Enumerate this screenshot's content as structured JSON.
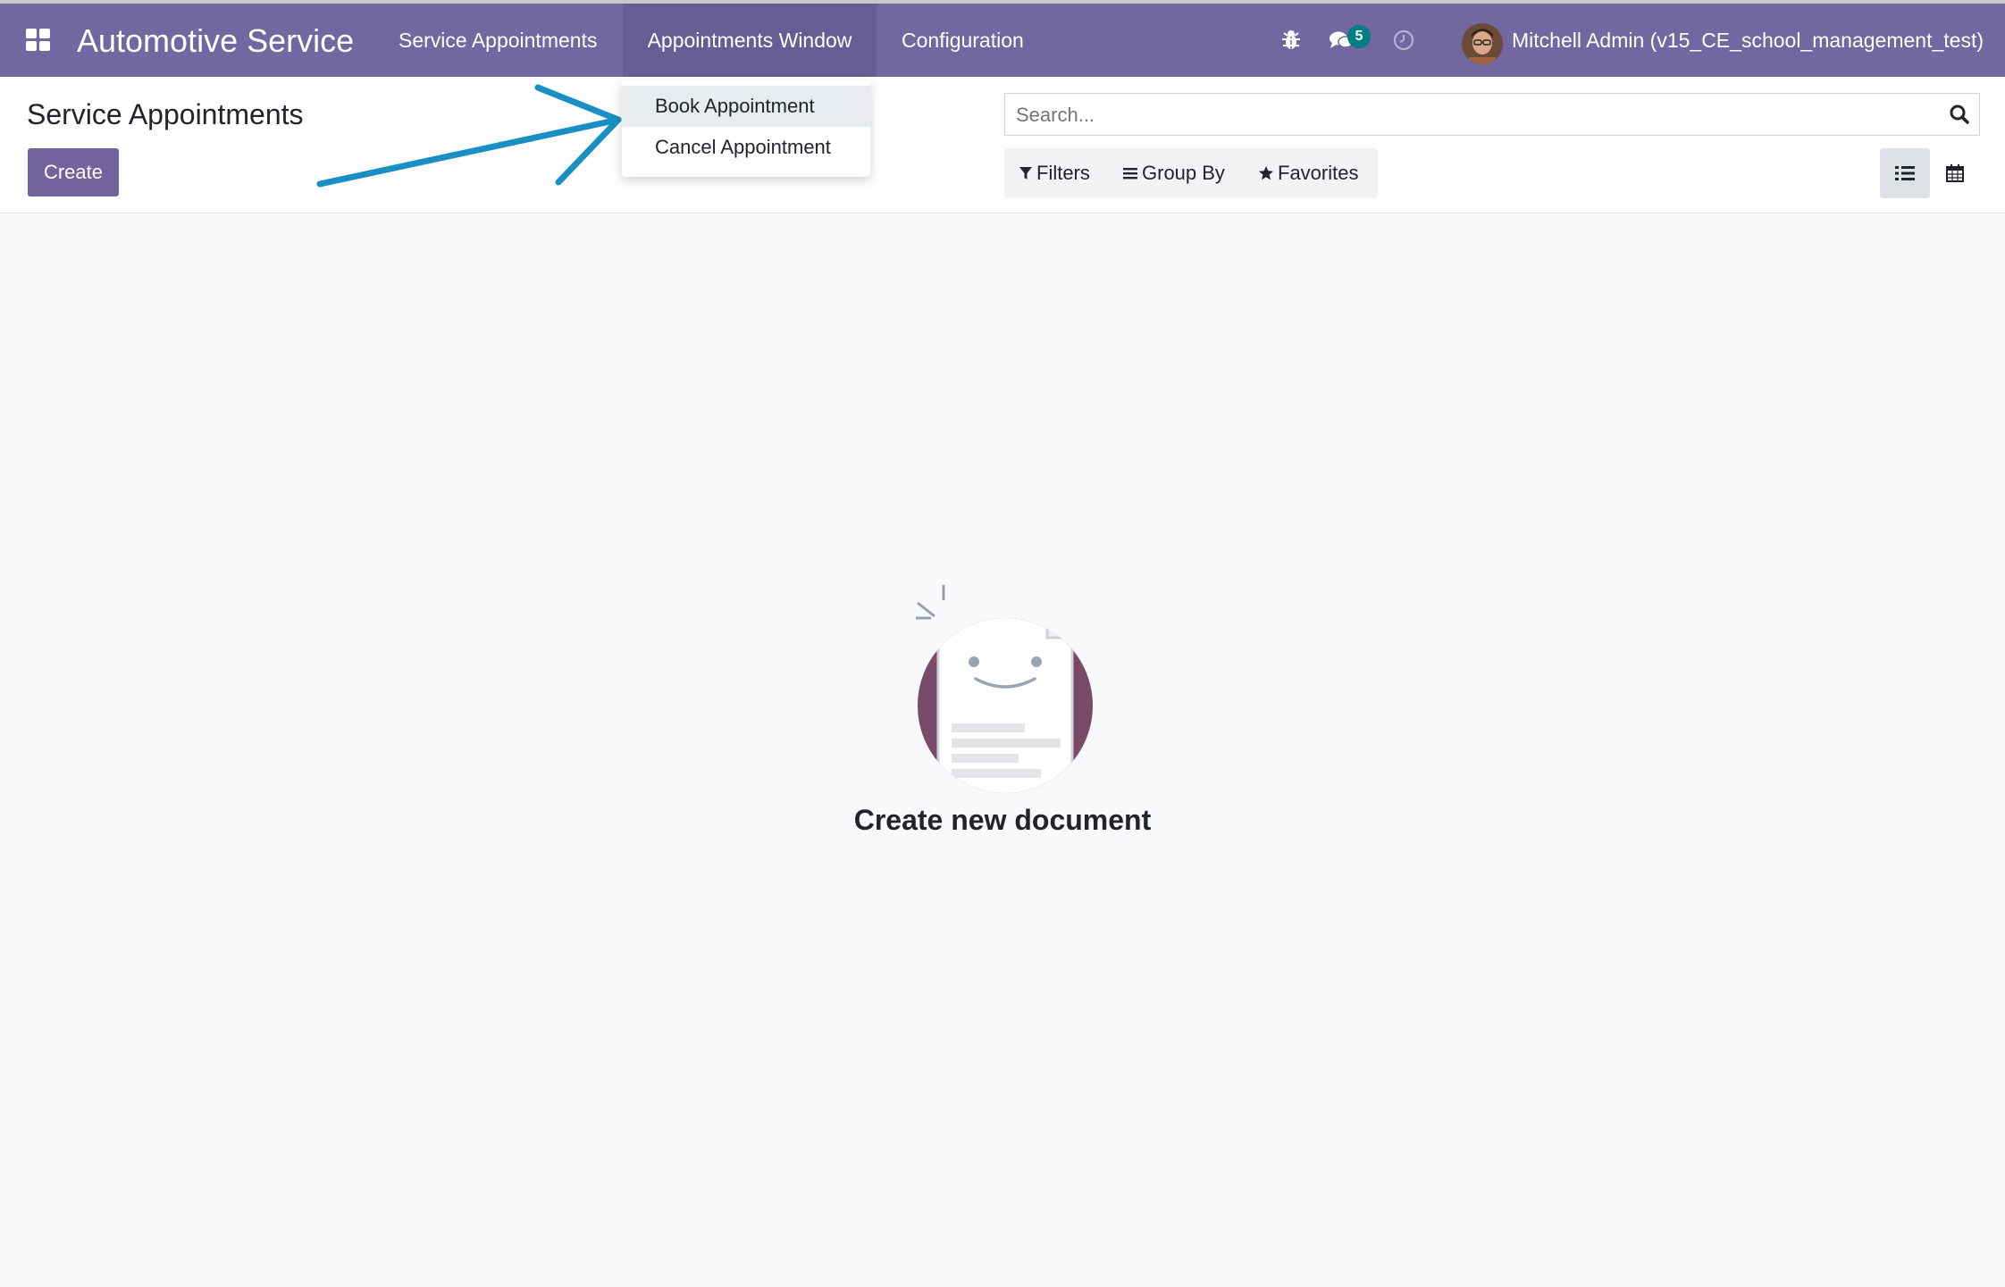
{
  "navbar": {
    "brand": "Automotive Service",
    "menu": [
      "Service Appointments",
      "Appointments Window",
      "Configuration"
    ],
    "active_menu": "Appointments Window",
    "messages_count": "5",
    "user": "Mitchell Admin (v15_CE_school_management_test)",
    "color": "#7267a0",
    "icons": [
      "apps-grid-icon",
      "bug-icon",
      "chat-icon",
      "clock-icon",
      "avatar"
    ]
  },
  "dropdown": {
    "items": [
      "Book Appointment",
      "Cancel Appointment"
    ],
    "highlighted": "Book Appointment"
  },
  "control": {
    "title": "Service Appointments",
    "create_label": "Create",
    "search_placeholder": "Search...",
    "filters_label": "Filters",
    "groupby_label": "Group By",
    "favorites_label": "Favorites",
    "active_view": "list"
  },
  "helper": {
    "text": "Create new document"
  },
  "annotation": {
    "arrow_color": "#1a8fc4"
  }
}
